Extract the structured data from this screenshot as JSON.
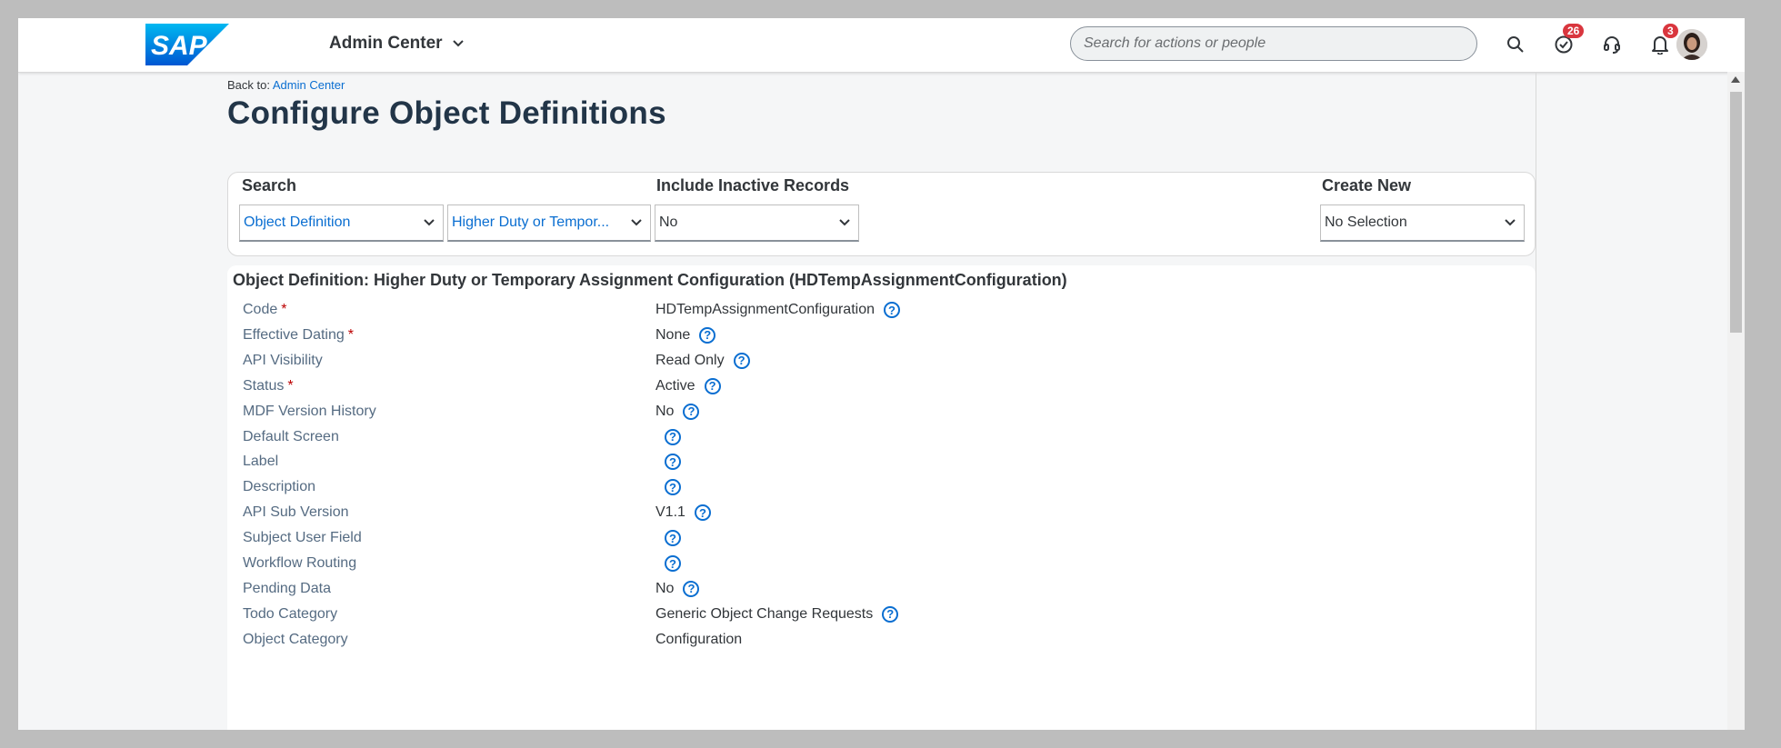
{
  "header": {
    "logo_text": "SAP",
    "app_title": "Admin Center",
    "search_placeholder": "Search for actions or people",
    "todo_badge": "26",
    "notifications_badge": "3"
  },
  "back": {
    "prefix": "Back to:",
    "link": "Admin Center"
  },
  "page_title": "Configure Object Definitions",
  "search_panel": {
    "search_label": "Search",
    "inactive_label": "Include Inactive Records",
    "create_label": "Create New",
    "type_value": "Object Definition",
    "object_value": "Higher Duty or Temporary Assignment Configuration",
    "object_display": "Higher Duty or Tempor...",
    "inactive_value": "No",
    "create_value": "No Selection"
  },
  "detail": {
    "title": "Object Definition: Higher Duty or Temporary Assignment Configuration (HDTempAssignmentConfiguration)",
    "rows": [
      {
        "label": "Code",
        "required": true,
        "value": "HDTempAssignmentConfiguration",
        "help": true
      },
      {
        "label": "Effective Dating",
        "required": true,
        "value": "None",
        "help": true
      },
      {
        "label": "API Visibility",
        "required": false,
        "value": "Read Only",
        "help": true
      },
      {
        "label": "Status",
        "required": true,
        "value": "Active",
        "help": true
      },
      {
        "label": "MDF Version History",
        "required": false,
        "value": "No",
        "help": true
      },
      {
        "label": "Default Screen",
        "required": false,
        "value": "",
        "help": true
      },
      {
        "label": "Label",
        "required": false,
        "value": "",
        "help": true
      },
      {
        "label": "Description",
        "required": false,
        "value": "",
        "help": true
      },
      {
        "label": "API Sub Version",
        "required": false,
        "value": "V1.1",
        "help": true
      },
      {
        "label": "Subject User Field",
        "required": false,
        "value": "",
        "help": true
      },
      {
        "label": "Workflow Routing",
        "required": false,
        "value": "",
        "help": true
      },
      {
        "label": "Pending Data",
        "required": false,
        "value": "No",
        "help": true
      },
      {
        "label": "Todo Category",
        "required": false,
        "value": "Generic Object Change Requests",
        "help": true
      },
      {
        "label": "Object Category",
        "required": false,
        "value": "Configuration",
        "help": false
      }
    ]
  },
  "colors": {
    "brand_blue": "#0a6ed1",
    "badge_red": "#d9363e",
    "title_navy": "#223548"
  }
}
